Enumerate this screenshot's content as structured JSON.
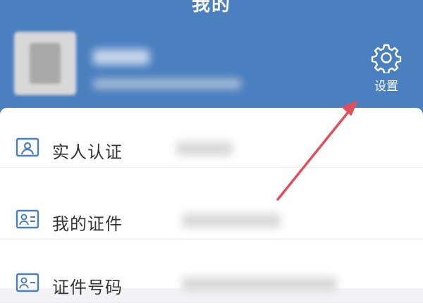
{
  "header": {
    "title": "我的",
    "settings_label": "设置"
  },
  "list": {
    "items": [
      {
        "label": "实人认证",
        "icon": "person-card-icon"
      },
      {
        "label": "我的证件",
        "icon": "id-card-icon"
      },
      {
        "label": "证件号码",
        "icon": "id-number-icon"
      }
    ]
  },
  "colors": {
    "header_bg": "#4a7fc0",
    "icon_blue": "#4a7fc0",
    "annotation_arrow": "#e0505a"
  }
}
